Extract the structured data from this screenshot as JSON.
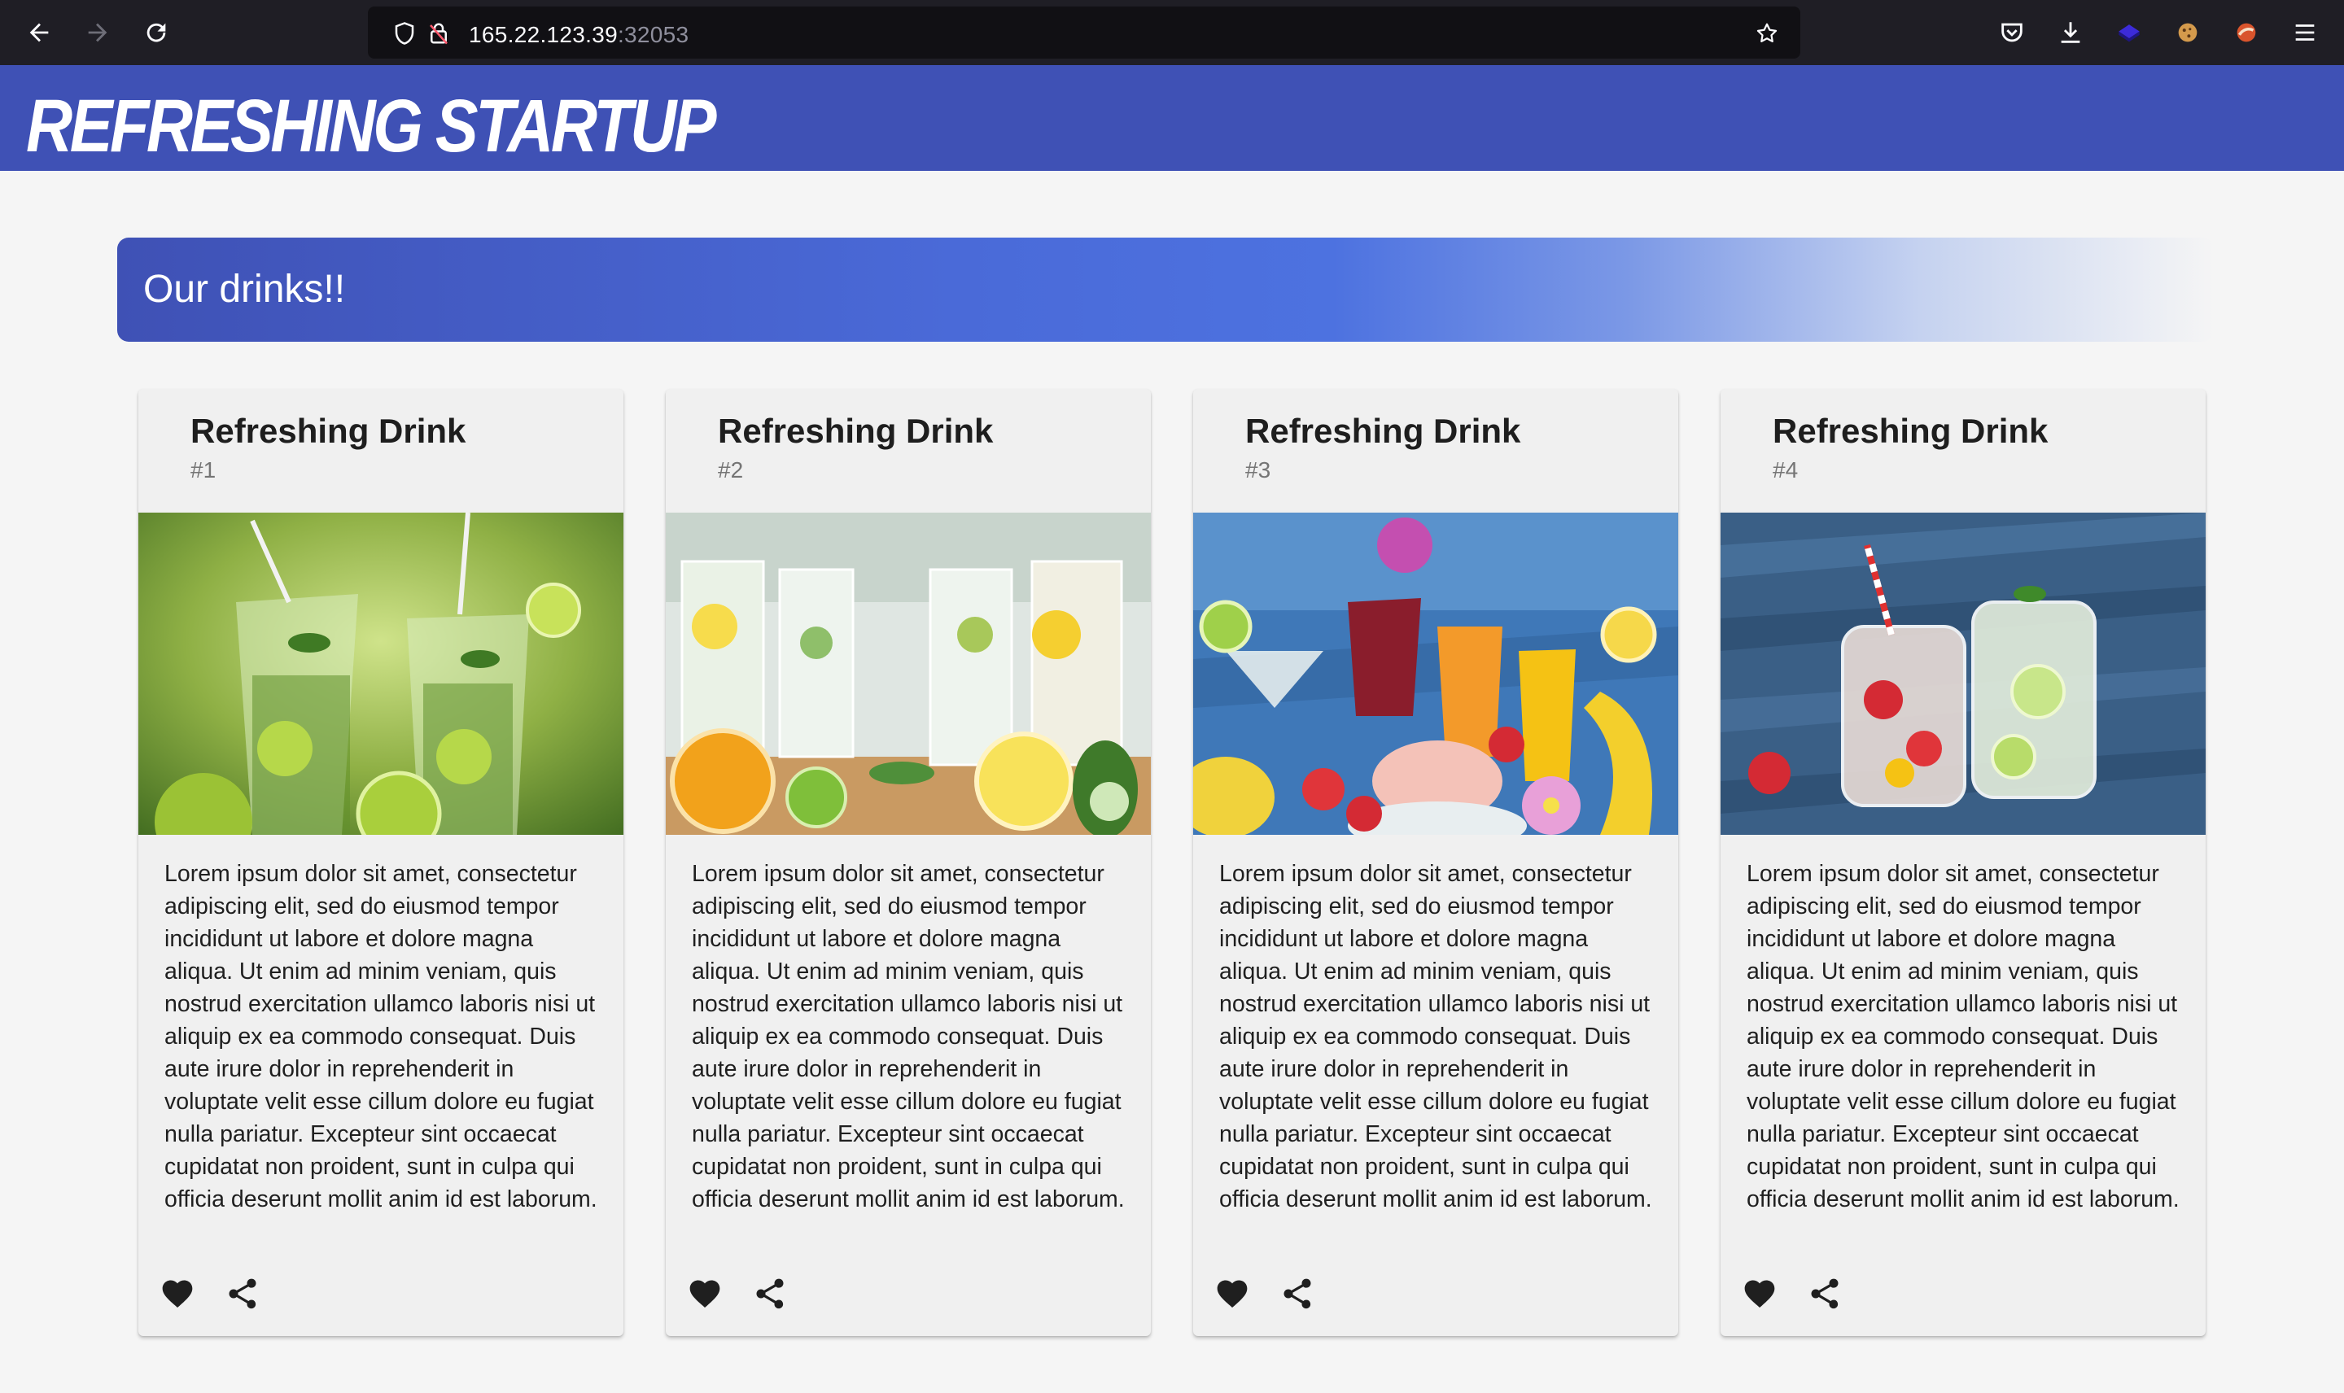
{
  "browser": {
    "url_host": "165.22.123.39",
    "url_port": ":32053"
  },
  "header": {
    "title": "REFRESHING STARTUP"
  },
  "banner": {
    "title": "Our drinks!!"
  },
  "cards": [
    {
      "title": "Refreshing Drink",
      "subtitle": "#1",
      "image": "lime-mojito-glasses",
      "text": "Lorem ipsum dolor sit amet, consectetur adipiscing elit, sed do eiusmod tempor incididunt ut labore et dolore magna aliqua. Ut enim ad minim veniam, quis nostrud exercitation ullamco laboris nisi ut aliquip ex ea commodo consequat. Duis aute irure dolor in reprehenderit in voluptate velit esse cillum dolore eu fugiat nulla pariatur. Excepteur sint occaecat cupidatat non proident, sunt in culpa qui officia deserunt mollit anim id est laborum."
    },
    {
      "title": "Refreshing Drink",
      "subtitle": "#2",
      "image": "citrus-infused-water-glasses",
      "text": "Lorem ipsum dolor sit amet, consectetur adipiscing elit, sed do eiusmod tempor incididunt ut labore et dolore magna aliqua. Ut enim ad minim veniam, quis nostrud exercitation ullamco laboris nisi ut aliquip ex ea commodo consequat. Duis aute irure dolor in reprehenderit in voluptate velit esse cillum dolore eu fugiat nulla pariatur. Excepteur sint occaecat cupidatat non proident, sunt in culpa qui officia deserunt mollit anim id est laborum."
    },
    {
      "title": "Refreshing Drink",
      "subtitle": "#3",
      "image": "tropical-cocktails",
      "text": "Lorem ipsum dolor sit amet, consectetur adipiscing elit, sed do eiusmod tempor incididunt ut labore et dolore magna aliqua. Ut enim ad minim veniam, quis nostrud exercitation ullamco laboris nisi ut aliquip ex ea commodo consequat. Duis aute irure dolor in reprehenderit in voluptate velit esse cillum dolore eu fugiat nulla pariatur. Excepteur sint occaecat cupidatat non proident, sunt in culpa qui officia deserunt mollit anim id est laborum."
    },
    {
      "title": "Refreshing Drink",
      "subtitle": "#4",
      "image": "fruit-water-mason-jars",
      "text": "Lorem ipsum dolor sit amet, consectetur adipiscing elit, sed do eiusmod tempor incididunt ut labore et dolore magna aliqua. Ut enim ad minim veniam, quis nostrud exercitation ullamco laboris nisi ut aliquip ex ea commodo consequat. Duis aute irure dolor in reprehenderit in voluptate velit esse cillum dolore eu fugiat nulla pariatur. Excepteur sint occaecat cupidatat non proident, sunt in culpa qui officia deserunt mollit anim id est laborum."
    }
  ],
  "icons": {
    "back": "back-arrow-icon",
    "forward": "forward-arrow-icon",
    "reload": "reload-icon",
    "shield": "tracking-protection-icon",
    "lock": "insecure-lock-icon",
    "star": "bookmark-star-icon",
    "pocket": "pocket-icon",
    "download": "download-icon",
    "menu": "hamburger-menu-icon",
    "favorite": "heart-icon",
    "share": "share-icon"
  },
  "colors": {
    "header": "#3f51b5",
    "banner_start": "#3f51b5",
    "banner_mid": "#4d72e0",
    "page_bg": "#f5f5f5",
    "card_bg": "#f0f0f0"
  }
}
